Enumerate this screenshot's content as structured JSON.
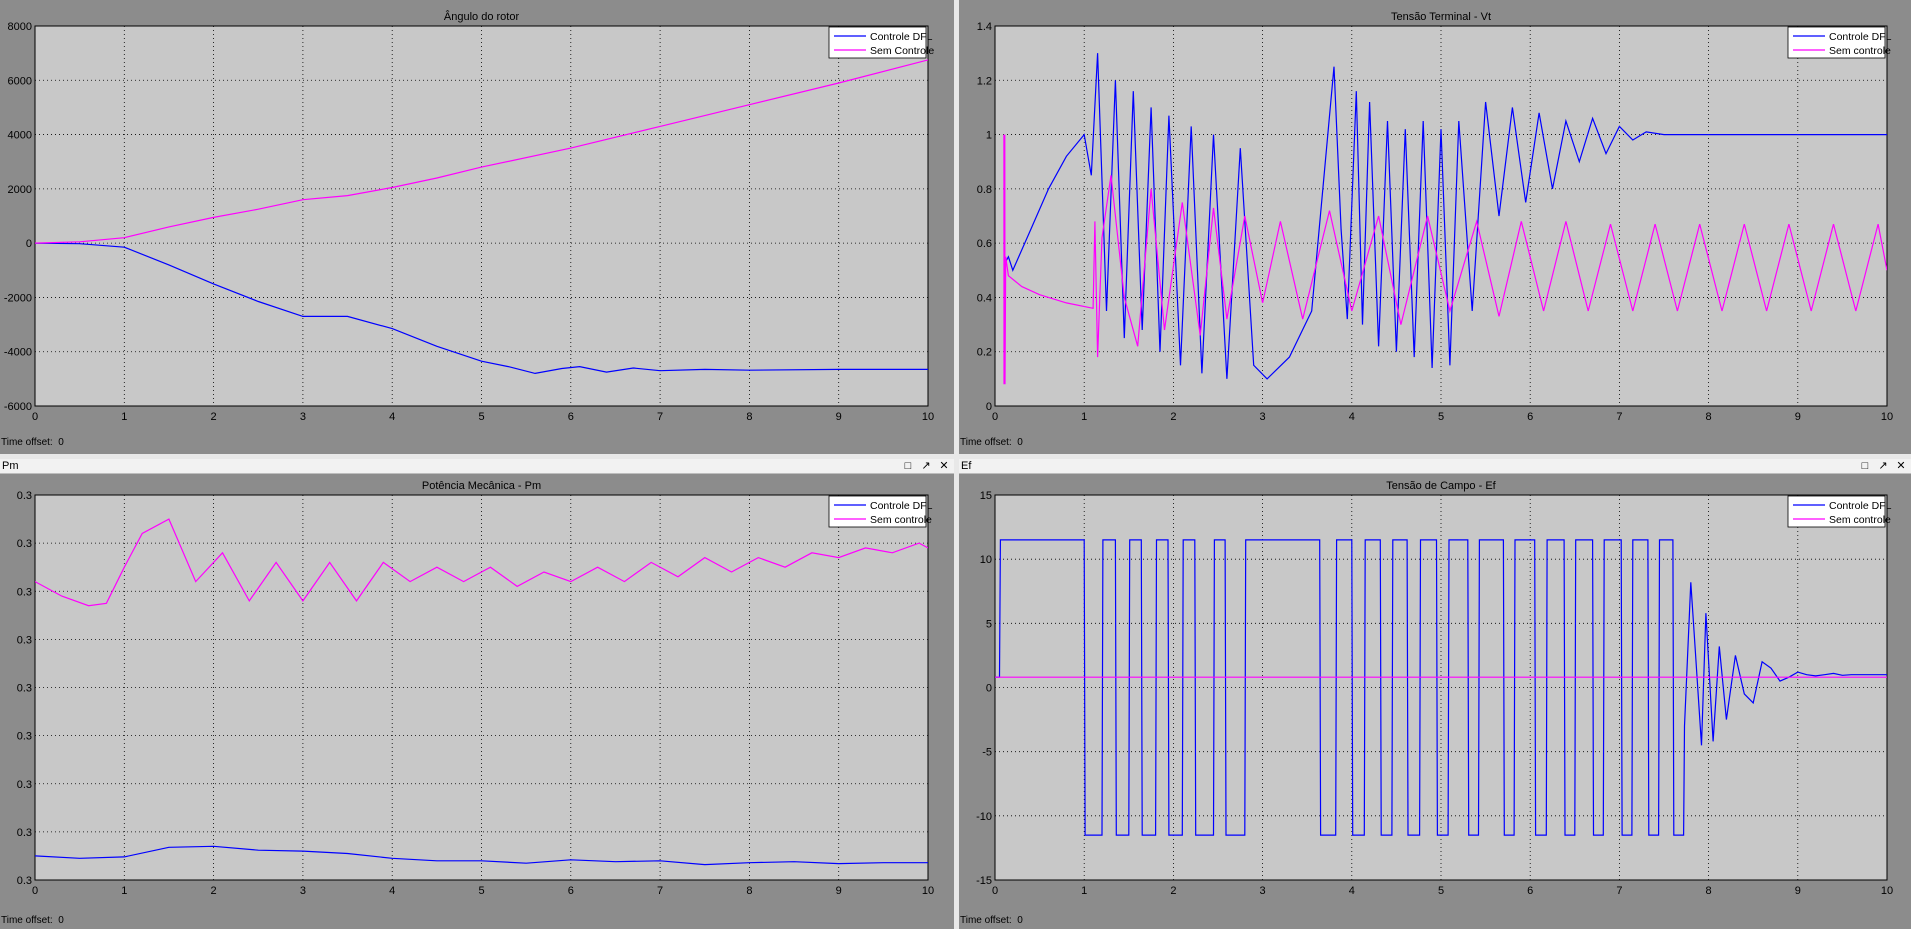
{
  "colors": {
    "blue": "#0000ff",
    "magenta": "#ff00ff",
    "axes_bg": "#c8c8c8",
    "figure_bg": "#8c8c8c"
  },
  "windows": [
    {
      "title": "",
      "controls": [],
      "time_offset_label": "Time offset:",
      "time_offset_value": "0"
    },
    {
      "title": "",
      "controls": [],
      "time_offset_label": "Time offset:",
      "time_offset_value": "0"
    },
    {
      "title": "Pm",
      "controls": [
        "□",
        "↗",
        "✕"
      ],
      "time_offset_label": "Time offset:",
      "time_offset_value": "0"
    },
    {
      "title": "Ef",
      "controls": [
        "□",
        "↗",
        "✕"
      ],
      "time_offset_label": "Time offset:",
      "time_offset_value": "0"
    }
  ],
  "chart_data": [
    {
      "type": "line",
      "title": "Ângulo do rotor",
      "xlabel": "",
      "ylabel": "",
      "xlim": [
        0,
        10
      ],
      "ylim": [
        -6000,
        8000
      ],
      "xticks": [
        "0",
        "1",
        "2",
        "3",
        "4",
        "5",
        "6",
        "7",
        "8",
        "9",
        "10"
      ],
      "yticks": [
        "-6000",
        "-4000",
        "-2000",
        "0",
        "2000",
        "4000",
        "6000",
        "8000"
      ],
      "grid": true,
      "legend_position": "top-right",
      "series": [
        {
          "name": "Controle DFL",
          "color": "#0000ff",
          "x": [
            0,
            0.5,
            1,
            1.5,
            2,
            2.5,
            3,
            3.5,
            4,
            4.5,
            5,
            5.3,
            5.6,
            5.9,
            6.1,
            6.4,
            6.7,
            7,
            7.5,
            8,
            9,
            10
          ],
          "y": [
            0,
            -20,
            -150,
            -800,
            -1500,
            -2150,
            -2700,
            -2700,
            -3150,
            -3800,
            -4350,
            -4550,
            -4800,
            -4620,
            -4550,
            -4750,
            -4600,
            -4700,
            -4650,
            -4680,
            -4650,
            -4650
          ]
        },
        {
          "name": "Sem Controle",
          "color": "#ff00ff",
          "x": [
            0,
            0.5,
            1,
            1.5,
            2,
            2.5,
            3,
            3.5,
            4,
            4.5,
            5,
            6,
            7,
            8,
            9,
            10
          ],
          "y": [
            0,
            50,
            200,
            600,
            950,
            1250,
            1600,
            1750,
            2050,
            2400,
            2800,
            3500,
            4300,
            5100,
            5900,
            6750
          ]
        }
      ]
    },
    {
      "type": "line",
      "title": "Tensão Terminal - Vt",
      "xlabel": "",
      "ylabel": "",
      "xlim": [
        0,
        10
      ],
      "ylim": [
        0,
        1.4
      ],
      "xticks": [
        "0",
        "1",
        "2",
        "3",
        "4",
        "5",
        "6",
        "7",
        "8",
        "9",
        "10"
      ],
      "yticks": [
        "0",
        "0.2",
        "0.4",
        "0.6",
        "0.8",
        "1",
        "1.2",
        "1.4"
      ],
      "grid": true,
      "legend_position": "top-right",
      "series": [
        {
          "name": "Controle DFL",
          "color": "#0000ff",
          "x": [
            0.1,
            0.15,
            0.2,
            0.4,
            0.6,
            0.8,
            1,
            1.08,
            1.15,
            1.25,
            1.35,
            1.45,
            1.55,
            1.65,
            1.75,
            1.85,
            1.95,
            2.08,
            2.2,
            2.32,
            2.45,
            2.6,
            2.75,
            2.9,
            3.05,
            3.3,
            3.55,
            3.8,
            3.88,
            3.95,
            4.05,
            4.12,
            4.2,
            4.3,
            4.4,
            4.5,
            4.6,
            4.7,
            4.8,
            4.9,
            5,
            5.1,
            5.2,
            5.35,
            5.5,
            5.65,
            5.8,
            5.95,
            6.1,
            6.25,
            6.4,
            6.55,
            6.7,
            6.85,
            7,
            7.15,
            7.3,
            7.5,
            7.7,
            8,
            8.5,
            9,
            9.5,
            10
          ],
          "y": [
            0.52,
            0.55,
            0.5,
            0.65,
            0.8,
            0.92,
            1.0,
            0.85,
            1.3,
            0.35,
            1.2,
            0.25,
            1.16,
            0.28,
            1.1,
            0.2,
            1.07,
            0.15,
            1.03,
            0.12,
            1.0,
            0.1,
            0.95,
            0.15,
            0.1,
            0.18,
            0.35,
            1.25,
            0.65,
            0.32,
            1.16,
            0.3,
            1.12,
            0.22,
            1.05,
            0.2,
            1.02,
            0.18,
            1.05,
            0.14,
            1.02,
            0.15,
            1.05,
            0.35,
            1.12,
            0.7,
            1.1,
            0.75,
            1.08,
            0.8,
            1.05,
            0.9,
            1.06,
            0.93,
            1.03,
            0.98,
            1.01,
            1.0,
            1.0,
            1.0,
            1.0,
            1.0,
            1.0,
            1.0
          ]
        },
        {
          "name": "Sem controle",
          "color": "#ff00ff",
          "x": [
            0.1,
            0.101,
            0.11,
            0.112,
            0.12,
            0.15,
            0.3,
            0.5,
            0.8,
            1.1,
            1.12,
            1.15,
            1.2,
            1.3,
            1.45,
            1.6,
            1.75,
            1.9,
            2.1,
            2.3,
            2.45,
            2.6,
            2.8,
            3.0,
            3.2,
            3.45,
            3.75,
            4.0,
            4.3,
            4.55,
            4.85,
            5.1,
            5.4,
            5.65,
            5.9,
            6.15,
            6.4,
            6.65,
            6.9,
            7.15,
            7.4,
            7.65,
            7.9,
            8.15,
            8.4,
            8.65,
            8.9,
            9.15,
            9.4,
            9.65,
            9.9,
            10
          ],
          "y": [
            1.0,
            0.08,
            1.0,
            0.08,
            0.55,
            0.48,
            0.44,
            0.41,
            0.38,
            0.36,
            0.68,
            0.18,
            0.62,
            0.85,
            0.4,
            0.22,
            0.8,
            0.28,
            0.75,
            0.26,
            0.73,
            0.32,
            0.7,
            0.38,
            0.68,
            0.32,
            0.72,
            0.35,
            0.7,
            0.3,
            0.7,
            0.35,
            0.68,
            0.33,
            0.68,
            0.35,
            0.68,
            0.35,
            0.67,
            0.35,
            0.67,
            0.35,
            0.67,
            0.35,
            0.67,
            0.35,
            0.67,
            0.35,
            0.67,
            0.35,
            0.67,
            0.5
          ]
        }
      ]
    },
    {
      "type": "line",
      "title": "Potência Mecânica - Pm",
      "xlabel": "",
      "ylabel": "",
      "xlim": [
        0,
        10
      ],
      "ylim": [
        0,
        8
      ],
      "xticks": [
        "0",
        "1",
        "2",
        "3",
        "4",
        "5",
        "6",
        "7",
        "8",
        "9",
        "10"
      ],
      "yticks": [
        "0.3",
        "0.3",
        "0.3",
        "0.3",
        "0.3",
        "0.3",
        "0.3",
        "0.3",
        "0.3"
      ],
      "grid": true,
      "legend_position": "top-right",
      "series": [
        {
          "name": "Controle DFL",
          "color": "#0000ff",
          "x": [
            0,
            0.5,
            1,
            1.5,
            2,
            2.5,
            3,
            3.5,
            4,
            4.5,
            5,
            5.5,
            6,
            6.5,
            7,
            7.5,
            8,
            8.5,
            9,
            9.5,
            10
          ],
          "y": [
            0.5,
            0.45,
            0.48,
            0.68,
            0.7,
            0.62,
            0.6,
            0.55,
            0.45,
            0.4,
            0.4,
            0.35,
            0.42,
            0.38,
            0.4,
            0.32,
            0.36,
            0.38,
            0.34,
            0.36,
            0.36
          ]
        },
        {
          "name": "Sem controle",
          "color": "#ff00ff",
          "x": [
            0,
            0.3,
            0.6,
            0.8,
            1.0,
            1.2,
            1.5,
            1.8,
            2.1,
            2.4,
            2.7,
            3.0,
            3.3,
            3.6,
            3.9,
            4.2,
            4.5,
            4.8,
            5.1,
            5.4,
            5.7,
            6.0,
            6.3,
            6.6,
            6.9,
            7.2,
            7.5,
            7.8,
            8.1,
            8.4,
            8.7,
            9.0,
            9.3,
            9.6,
            9.9,
            10
          ],
          "y": [
            6.2,
            5.9,
            5.7,
            5.75,
            6.5,
            7.2,
            7.5,
            6.2,
            6.8,
            5.8,
            6.6,
            5.8,
            6.6,
            5.8,
            6.6,
            6.2,
            6.5,
            6.2,
            6.5,
            6.1,
            6.4,
            6.2,
            6.5,
            6.2,
            6.6,
            6.3,
            6.7,
            6.4,
            6.7,
            6.5,
            6.8,
            6.7,
            6.9,
            6.8,
            7.0,
            6.9
          ]
        }
      ]
    },
    {
      "type": "line",
      "title": "Tensão de Campo - Ef",
      "xlabel": "",
      "ylabel": "",
      "xlim": [
        0,
        10
      ],
      "ylim": [
        -15,
        15
      ],
      "xticks": [
        "0",
        "1",
        "2",
        "3",
        "4",
        "5",
        "6",
        "7",
        "8",
        "9",
        "10"
      ],
      "yticks": [
        "-15",
        "-10",
        "-5",
        "0",
        "5",
        "10",
        "15"
      ],
      "grid": true,
      "legend_position": "top-right",
      "series": [
        {
          "name": "Controle DFL",
          "color": "#0000ff",
          "x": [
            0,
            0.05,
            0.06,
            1.0,
            1.01,
            1.2,
            1.21,
            1.35,
            1.36,
            1.5,
            1.51,
            1.64,
            1.65,
            1.8,
            1.81,
            1.94,
            1.95,
            2.1,
            2.11,
            2.24,
            2.25,
            2.45,
            2.46,
            2.58,
            2.59,
            2.8,
            2.81,
            2.94,
            2.95,
            3.64,
            3.65,
            3.82,
            3.83,
            4.0,
            4.01,
            4.14,
            4.15,
            4.32,
            4.33,
            4.45,
            4.46,
            4.62,
            4.63,
            4.76,
            4.77,
            4.95,
            4.96,
            5.08,
            5.09,
            5.3,
            5.31,
            5.42,
            5.43,
            5.7,
            5.71,
            5.82,
            5.83,
            6.05,
            6.06,
            6.18,
            6.19,
            6.38,
            6.39,
            6.5,
            6.51,
            6.7,
            6.71,
            6.82,
            6.83,
            7.02,
            7.03,
            7.14,
            7.15,
            7.32,
            7.33,
            7.44,
            7.45,
            7.6,
            7.61,
            7.72,
            7.73,
            7.8,
            7.85,
            7.92,
            7.97,
            8.05,
            8.12,
            8.2,
            8.3,
            8.4,
            8.5,
            8.6,
            8.7,
            8.8,
            8.9,
            9.0,
            9.1,
            9.2,
            9.3,
            9.4,
            9.5,
            9.6,
            9.8,
            10
          ],
          "y": [
            0.8,
            0.8,
            11.5,
            11.5,
            -11.5,
            -11.5,
            11.5,
            11.5,
            -11.5,
            -11.5,
            11.5,
            11.5,
            -11.5,
            -11.5,
            11.5,
            11.5,
            -11.5,
            -11.5,
            11.5,
            11.5,
            -11.5,
            -11.5,
            11.5,
            11.5,
            -11.5,
            -11.5,
            11.5,
            11.5,
            11.5,
            11.5,
            -11.5,
            -11.5,
            11.5,
            11.5,
            -11.5,
            -11.5,
            11.5,
            11.5,
            -11.5,
            -11.5,
            11.5,
            11.5,
            -11.5,
            -11.5,
            11.5,
            11.5,
            -11.5,
            -11.5,
            11.5,
            11.5,
            -11.5,
            -11.5,
            11.5,
            11.5,
            -11.5,
            -11.5,
            11.5,
            11.5,
            -11.5,
            -11.5,
            11.5,
            11.5,
            -11.5,
            -11.5,
            11.5,
            11.5,
            -11.5,
            -11.5,
            11.5,
            11.5,
            -11.5,
            -11.5,
            11.5,
            11.5,
            -11.5,
            -11.5,
            11.5,
            11.5,
            -11.5,
            -11.5,
            -3,
            8.2,
            3,
            -4.5,
            5.8,
            -4.2,
            3.2,
            -2.5,
            2.5,
            -0.5,
            -1.2,
            2.0,
            1.5,
            0.5,
            0.8,
            1.2,
            1.0,
            0.9,
            1.0,
            1.1,
            0.95,
            1.0,
            1.0,
            1.0
          ]
        },
        {
          "name": "Sem controle",
          "color": "#ff00ff",
          "x": [
            0,
            10
          ],
          "y": [
            0.8,
            0.8
          ]
        }
      ]
    }
  ]
}
